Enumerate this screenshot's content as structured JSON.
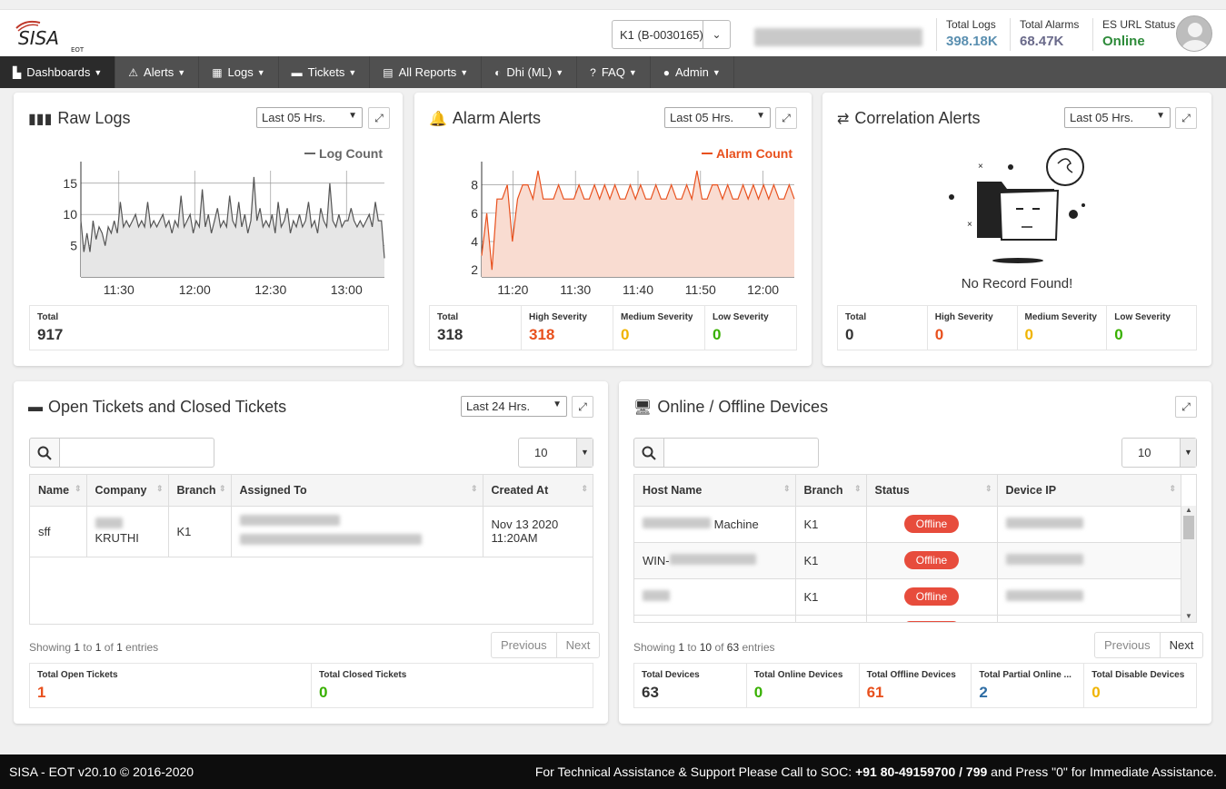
{
  "header": {
    "site_select": "K1 (B-0030165)",
    "stats": [
      {
        "label": "Total Logs",
        "value": "398.18K",
        "color": "#5a8fb0"
      },
      {
        "label": "Total Alarms",
        "value": "68.47K",
        "color": "#6a6a8a"
      },
      {
        "label": "ES URL Status",
        "value": "Online",
        "color": "#2e8b3a"
      }
    ]
  },
  "logo": {
    "text": "SISA",
    "sub": "EOT"
  },
  "nav": [
    {
      "label": "Dashboards",
      "icon": "chart-icon"
    },
    {
      "label": "Alerts",
      "icon": "warning-icon"
    },
    {
      "label": "Logs",
      "icon": "table-icon"
    },
    {
      "label": "Tickets",
      "icon": "ticket-icon"
    },
    {
      "label": "All Reports",
      "icon": "file-icon"
    },
    {
      "label": "Dhi (ML)",
      "icon": "brain-icon"
    },
    {
      "label": "FAQ",
      "icon": "question-icon"
    },
    {
      "label": "Admin",
      "icon": "user-icon"
    }
  ],
  "raw_logs": {
    "title": "Raw Logs",
    "range": "Last 05 Hrs.",
    "summary": [
      {
        "label": "Total",
        "value": "917"
      }
    ]
  },
  "alarm_alerts": {
    "title": "Alarm Alerts",
    "range": "Last 05 Hrs.",
    "summary": [
      {
        "label": "Total",
        "value": "318",
        "color": "#333"
      },
      {
        "label": "High Severity",
        "value": "318",
        "color": "#e8501d"
      },
      {
        "label": "Medium Severity",
        "value": "0",
        "color": "#f0b400"
      },
      {
        "label": "Low Severity",
        "value": "0",
        "color": "#38b000"
      }
    ]
  },
  "correlation_alerts": {
    "title": "Correlation Alerts",
    "range": "Last 05 Hrs.",
    "empty_text": "No Record Found!",
    "summary": [
      {
        "label": "Total",
        "value": "0",
        "color": "#333"
      },
      {
        "label": "High Severity",
        "value": "0",
        "color": "#e8501d"
      },
      {
        "label": "Medium Severity",
        "value": "0",
        "color": "#f0b400"
      },
      {
        "label": "Low Severity",
        "value": "0",
        "color": "#38b000"
      }
    ]
  },
  "tickets": {
    "title": "Open Tickets and Closed Tickets",
    "range": "Last 24 Hrs.",
    "page_size": "10",
    "columns": [
      "Name",
      "Company",
      "Branch",
      "Assigned To",
      "Created At"
    ],
    "rows": [
      {
        "name": "sff",
        "company": "KRUTHI",
        "branch": "K1",
        "created_date": "Nov 13 2020",
        "created_time": "11:20AM"
      }
    ],
    "showing_prefix": "Showing ",
    "showing_from": "1",
    "showing_to_word": " to ",
    "showing_to": "1",
    "showing_of_word": " of ",
    "showing_total": "1",
    "showing_suffix": " entries",
    "prev": "Previous",
    "next": "Next",
    "summary": [
      {
        "label": "Total Open Tickets",
        "value": "1",
        "color": "#e8501d"
      },
      {
        "label": "Total Closed Tickets",
        "value": "0",
        "color": "#38b000"
      }
    ]
  },
  "devices": {
    "title": "Online / Offline Devices",
    "page_size": "10",
    "columns": [
      "Host Name",
      "Branch",
      "Status",
      "Device IP"
    ],
    "rows": [
      {
        "host_suffix": "Machine",
        "branch": "K1",
        "status": "Offline"
      },
      {
        "host_prefix": "WIN-",
        "branch": "K1",
        "status": "Offline"
      },
      {
        "branch": "K1",
        "status": "Offline"
      }
    ],
    "showing_prefix": "Showing ",
    "showing_from": "1",
    "showing_to_word": " to ",
    "showing_to": "10",
    "showing_of_word": " of ",
    "showing_total": "63",
    "showing_suffix": " entries",
    "prev": "Previous",
    "next": "Next",
    "summary": [
      {
        "label": "Total Devices",
        "value": "63",
        "color": "#333"
      },
      {
        "label": "Total Online Devices",
        "value": "0",
        "color": "#38b000"
      },
      {
        "label": "Total Offline Devices",
        "value": "61",
        "color": "#e8501d"
      },
      {
        "label": "Total Partial Online ...",
        "value": "2",
        "color": "#2e6da4"
      },
      {
        "label": "Total Disable Devices",
        "value": "0",
        "color": "#f0b400"
      }
    ]
  },
  "footer": {
    "left": "SISA - EOT v20.10 © 2016-2020",
    "right_prefix": "For Technical Assistance & Support Please Call to SOC: ",
    "right_bold": "+91 80-49159700 / 799",
    "right_suffix": " and Press \"0\" for Immediate Assistance."
  },
  "chart_data": [
    {
      "type": "area",
      "legend": "Log Count",
      "x_ticks": [
        "11:30",
        "12:00",
        "12:30",
        "13:00"
      ],
      "y_ticks": [
        5,
        10,
        15
      ],
      "ylim": [
        0,
        17
      ],
      "color": "#555555",
      "values": [
        9,
        4,
        7,
        4,
        9,
        6,
        8,
        7,
        5,
        8,
        7,
        9,
        7,
        12,
        8,
        9,
        8,
        9,
        10,
        8,
        9,
        8,
        12,
        8,
        9,
        8,
        9,
        10,
        8,
        9,
        7,
        9,
        8,
        13,
        8,
        9,
        10,
        7,
        9,
        8,
        14,
        8,
        10,
        7,
        9,
        11,
        8,
        9,
        8,
        13,
        9,
        8,
        12,
        8,
        10,
        7,
        9,
        16,
        9,
        11,
        8,
        9,
        8,
        10,
        7,
        12,
        8,
        9,
        11,
        7,
        9,
        8,
        10,
        8,
        9,
        12,
        8,
        9,
        7,
        11,
        9,
        8,
        15,
        9,
        8,
        10,
        8,
        9,
        9,
        11,
        9,
        8,
        9,
        8,
        9,
        10,
        8,
        12,
        9,
        9,
        3
      ]
    },
    {
      "type": "area",
      "legend": "Alarm Count",
      "x_ticks": [
        "11:20",
        "11:30",
        "11:40",
        "11:50",
        "12:00"
      ],
      "y_ticks": [
        2,
        4,
        6,
        8
      ],
      "ylim": [
        1.5,
        9
      ],
      "color": "#e8501d",
      "values": [
        3,
        6,
        2,
        7,
        7,
        8,
        4,
        7,
        8,
        8,
        7,
        9,
        7,
        7,
        7,
        8,
        7,
        7,
        7,
        8,
        7,
        7,
        8,
        7,
        8,
        7,
        8,
        7,
        7,
        8,
        7,
        8,
        7,
        7,
        8,
        7,
        7,
        8,
        7,
        7,
        8,
        7,
        9,
        7,
        7,
        8,
        8,
        7,
        8,
        7,
        7,
        8,
        7,
        8,
        7,
        8,
        7,
        8,
        7,
        7,
        8,
        7
      ]
    }
  ]
}
